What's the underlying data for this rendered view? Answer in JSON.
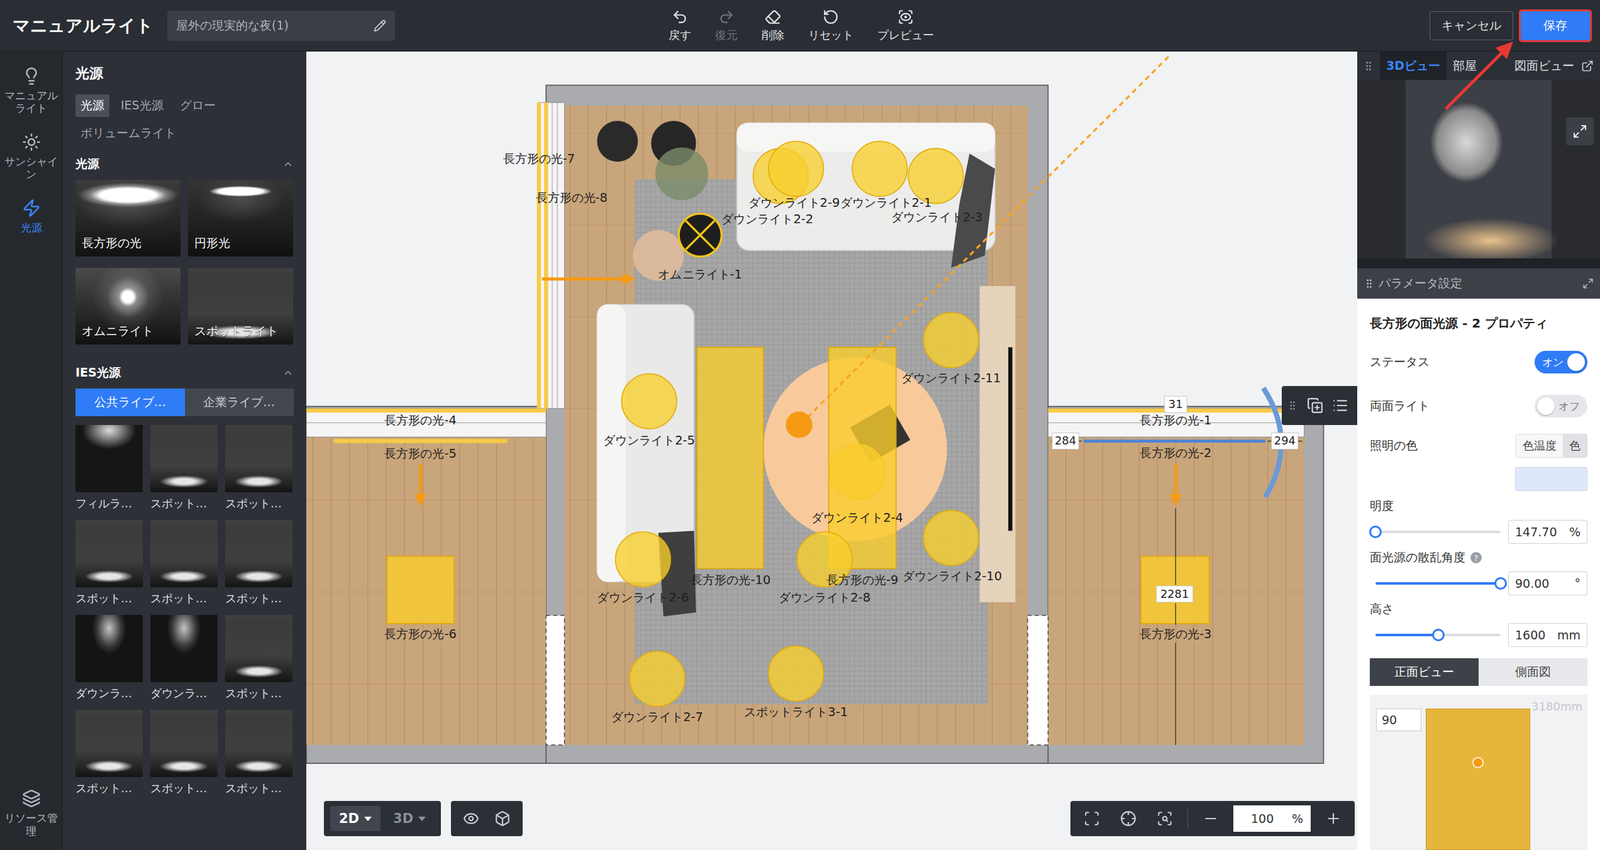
{
  "app": {
    "title": "マニュアルライト",
    "scene_name": "屋外の現実的な夜(1)"
  },
  "toolbar": [
    {
      "label": "戻す",
      "disabled": false
    },
    {
      "label": "復元",
      "disabled": true
    },
    {
      "label": "削除",
      "disabled": false
    },
    {
      "label": "リセット",
      "disabled": false
    },
    {
      "label": "プレビュー",
      "disabled": false
    }
  ],
  "actions": {
    "cancel": "キャンセル",
    "save": "保存",
    "save_annotated": true
  },
  "rail": {
    "items": [
      {
        "label": "マニュアルライト",
        "selected": false
      },
      {
        "label": "サンシャイン",
        "selected": false
      },
      {
        "label": "光源",
        "selected": true
      }
    ],
    "bottom": "リソース管理"
  },
  "library": {
    "title": "光源",
    "tabs": [
      {
        "label": "光源",
        "selected": true
      },
      {
        "label": "IES光源",
        "selected": false
      },
      {
        "label": "グロー",
        "selected": false
      },
      {
        "label": "ボリュームライト",
        "selected": false
      }
    ],
    "lights_section": {
      "title": "光源",
      "expanded": true,
      "items": [
        {
          "label": "長方形の光",
          "kind": "rect"
        },
        {
          "label": "円形光",
          "kind": "circle"
        },
        {
          "label": "オムニライト",
          "kind": "omni"
        },
        {
          "label": "スポットライト",
          "kind": "spot"
        }
      ]
    },
    "ies_section": {
      "title": "IES光源",
      "expanded": true,
      "tabs": [
        {
          "label": "公共ライブ…",
          "selected": true
        },
        {
          "label": "企業ライブ…",
          "selected": false
        }
      ],
      "items": [
        {
          "label": "フィルラ…",
          "kind": "fill"
        },
        {
          "label": "スポット…",
          "kind": "spot"
        },
        {
          "label": "スポット…",
          "kind": "spot"
        },
        {
          "label": "スポット…",
          "kind": "spot"
        },
        {
          "label": "スポット…",
          "kind": "spot"
        },
        {
          "label": "スポット…",
          "kind": "spot"
        },
        {
          "label": "ダウンラ…",
          "kind": "down"
        },
        {
          "label": "ダウンラ…",
          "kind": "down"
        },
        {
          "label": "スポット…",
          "kind": "spot"
        },
        {
          "label": "スポット…",
          "kind": "spot"
        },
        {
          "label": "スポット…",
          "kind": "spot"
        },
        {
          "label": "スポット…",
          "kind": "spot"
        }
      ]
    }
  },
  "canvas": {
    "lights": [
      {
        "name": "長方形の光-7",
        "kind": "line",
        "selected": false
      },
      {
        "name": "長方形の光-8",
        "kind": "line",
        "selected": false
      },
      {
        "name": "オムニライト-1",
        "kind": "omni",
        "selected": false
      },
      {
        "name": "ダウンライト2-2",
        "kind": "downlight",
        "selected": false
      },
      {
        "name": "ダウンライト2-9",
        "kind": "downlight",
        "selected": false
      },
      {
        "name": "ダウンライト2-1",
        "kind": "downlight",
        "selected": false
      },
      {
        "name": "ダウンライト2-3",
        "kind": "downlight",
        "selected": false
      },
      {
        "name": "長方形の光-4",
        "kind": "line",
        "selected": false
      },
      {
        "name": "長方形の光-5",
        "kind": "line",
        "selected": false
      },
      {
        "name": "ダウンライト2-5",
        "kind": "downlight",
        "selected": false
      },
      {
        "name": "ダウンライト2-11",
        "kind": "downlight",
        "selected": false
      },
      {
        "name": "長方形の光-1",
        "kind": "line",
        "selected": false
      },
      {
        "name": "長方形の光-2",
        "kind": "line",
        "selected": true
      },
      {
        "name": "長方形の光-6",
        "kind": "rect",
        "selected": false
      },
      {
        "name": "長方形の光-3",
        "kind": "rect",
        "selected": false
      },
      {
        "name": "ダウンライト2-4",
        "kind": "downlight",
        "selected": false
      },
      {
        "name": "長方形の光-10",
        "kind": "rect",
        "selected": false
      },
      {
        "name": "長方形の光-9",
        "kind": "rect",
        "selected": false
      },
      {
        "name": "ダウンライト2-10",
        "kind": "downlight",
        "selected": false
      },
      {
        "name": "ダウンライト2-6",
        "kind": "downlight",
        "selected": false
      },
      {
        "name": "ダウンライト2-8",
        "kind": "downlight",
        "selected": false
      },
      {
        "name": "ダウンライト2-7",
        "kind": "downlight",
        "selected": false
      },
      {
        "name": "スポットライト3-1",
        "kind": "spot",
        "selected": false
      }
    ],
    "dimensions": [
      "284",
      "294",
      "31",
      "2281"
    ],
    "view_modes": [
      {
        "label": "2D",
        "selected": true
      },
      {
        "label": "3D",
        "selected": false
      }
    ],
    "zoom": {
      "value": "100",
      "unit": "%"
    }
  },
  "right_panel": {
    "view_tabs": [
      {
        "label": "3Dビュー",
        "selected": true
      },
      {
        "label": "部屋",
        "selected": false
      },
      {
        "label": "図面ビュー",
        "selected": false
      }
    ],
    "params": {
      "title": "パラメータ設定",
      "heading": "長方形の面光源 - 2 プロパティ",
      "toggles": [
        {
          "label": "ステータス",
          "on": true,
          "text": "オン"
        },
        {
          "label": "両面ライト",
          "on": false,
          "text": "オフ"
        }
      ],
      "color": {
        "label": "照明の色",
        "modes": [
          {
            "label": "色温度",
            "selected": false
          },
          {
            "label": "色",
            "selected": true
          }
        ],
        "value": "#dfe7fb"
      },
      "sliders": [
        {
          "label": "明度",
          "level": 0.0,
          "value": "147.70",
          "unit": "%",
          "help": ""
        },
        {
          "label": "面光源の散乱角度",
          "level": 1.0,
          "value": "90.00",
          "unit": "°",
          "help": "?"
        },
        {
          "label": "高さ",
          "level": 0.5,
          "value": "1600",
          "unit": "mm",
          "help": ""
        }
      ],
      "view_tabs": [
        {
          "label": "正面ビュー",
          "selected": true
        },
        {
          "label": "側面図",
          "selected": false
        }
      ],
      "diagram": {
        "angle": "90",
        "height": "3180mm"
      }
    }
  }
}
